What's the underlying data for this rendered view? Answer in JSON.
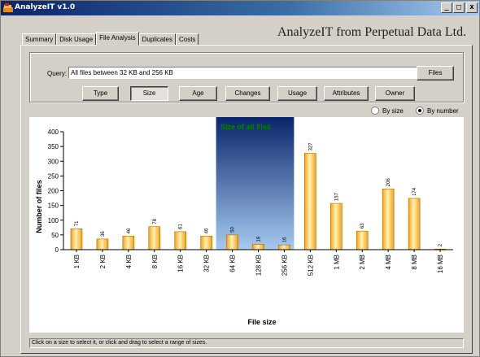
{
  "window": {
    "title": "AnalyzeIT v1.0",
    "minimize_glyph": "_",
    "maximize_glyph": "□",
    "close_glyph": "x"
  },
  "tabs": [
    {
      "label": "Summary",
      "active": false
    },
    {
      "label": "Disk Usage",
      "active": false
    },
    {
      "label": "File Analysis",
      "active": true
    },
    {
      "label": "Duplicates",
      "active": false
    },
    {
      "label": "Costs",
      "active": false
    }
  ],
  "brand": "AnalyzeIT from Perpetual Data Ltd.",
  "query": {
    "label": "Query:",
    "value": "All files between 32 KB and 256 KB",
    "files_button": "Files"
  },
  "analysis_buttons": [
    {
      "label": "Type",
      "pressed": false
    },
    {
      "label": "Size",
      "pressed": true
    },
    {
      "label": "Age",
      "pressed": false
    },
    {
      "label": "Changes",
      "pressed": false
    },
    {
      "label": "Usage",
      "pressed": false
    },
    {
      "label": "Attributes",
      "pressed": false
    },
    {
      "label": "Owner",
      "pressed": false
    }
  ],
  "sort": {
    "by_size_label": "By size",
    "by_number_label": "By number",
    "selected": "by_number"
  },
  "colors": {
    "title_green": "#008000",
    "bar_fill_light": "#fff2b0",
    "bar_fill_dark": "#f0a020",
    "selection_dark": "#0a246a",
    "selection_light": "#a6caf0"
  },
  "chart_data": {
    "type": "bar",
    "title": "Size of all files",
    "xlabel": "File size",
    "ylabel": "Number of files",
    "ylim": [
      0,
      400
    ],
    "yticks": [
      0,
      50,
      100,
      150,
      200,
      250,
      300,
      350,
      400
    ],
    "categories": [
      "1 KB",
      "2 KB",
      "4 KB",
      "8 KB",
      "16 KB",
      "32 KB",
      "64 KB",
      "128 KB",
      "256 KB",
      "512 KB",
      "1 MB",
      "2 MB",
      "4 MB",
      "8 MB",
      "16 MB"
    ],
    "values": [
      71,
      36,
      46,
      78,
      61,
      46,
      50,
      18,
      16,
      327,
      157,
      63,
      206,
      174,
      2
    ],
    "selected_range": [
      "64 KB",
      "256 KB"
    ],
    "grid": false,
    "data_labels": true
  },
  "status": "Click on a size to select it, or click and drag to select a range of sizes."
}
